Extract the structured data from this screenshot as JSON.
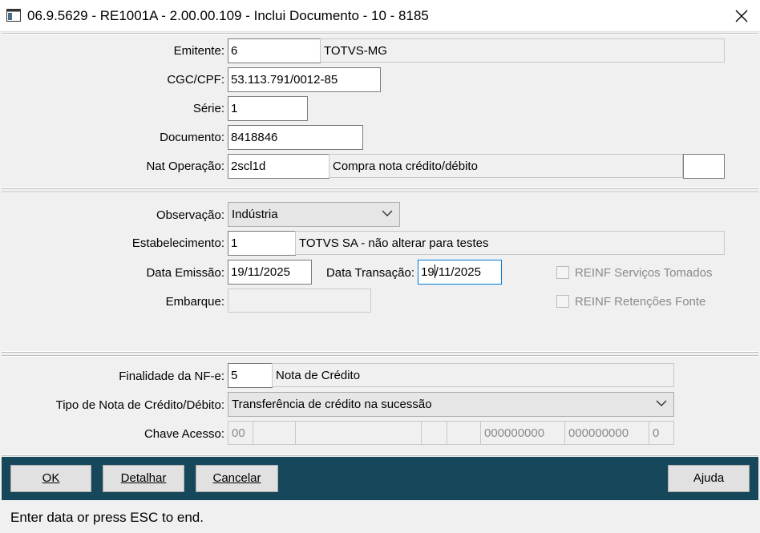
{
  "window": {
    "title": "06.9.5629 - RE1001A - 2.00.00.109 - Inclui Documento - 10 - 8185",
    "icon": "app-window-icon",
    "close_icon": "close-icon"
  },
  "section1": {
    "emitente_label": "Emitente:",
    "emitente_code": "6",
    "emitente_name": "TOTVS-MG",
    "cgc_label": "CGC/CPF:",
    "cgc_value": "53.113.791/0012-85",
    "serie_label": "Série:",
    "serie_value": "1",
    "documento_label": "Documento:",
    "documento_value": "8418846",
    "natop_label": "Nat Operação:",
    "natop_code": "2scl1d",
    "natop_desc": "Compra nota crédito/débito",
    "natop_extra": ""
  },
  "section2": {
    "observacao_label": "Observação:",
    "observacao_value": "Indústria",
    "estab_label": "Estabelecimento:",
    "estab_code": "1",
    "estab_desc": "TOTVS SA - não alterar para testes",
    "data_emissao_label": "Data Emissão:",
    "data_emissao_value": "19/11/2025",
    "data_transacao_label": "Data Transação:",
    "data_transacao_before": "19",
    "data_transacao_after": "/11/2025",
    "embarque_label": "Embarque:",
    "embarque_value": "",
    "reinf_servicos_label": "REINF Serviços Tomados",
    "reinf_retencoes_label": "REINF Retenções Fonte"
  },
  "section3": {
    "finalidade_label": "Finalidade da NF-e:",
    "finalidade_code": "5",
    "finalidade_desc": "Nota de Crédito",
    "tipo_nota_label": "Tipo de Nota de Crédito/Débito:",
    "tipo_nota_value": "Transferência de crédito na sucessão",
    "chave_label": "Chave Acesso:",
    "chave_parts": [
      "00",
      "",
      "",
      "",
      "",
      "000000000",
      "000000000",
      "0"
    ]
  },
  "buttons": {
    "ok": "OK",
    "detalhar": "Detalhar",
    "cancelar": "Cancelar",
    "ajuda": "Ajuda"
  },
  "status": "Enter data or press ESC to end."
}
